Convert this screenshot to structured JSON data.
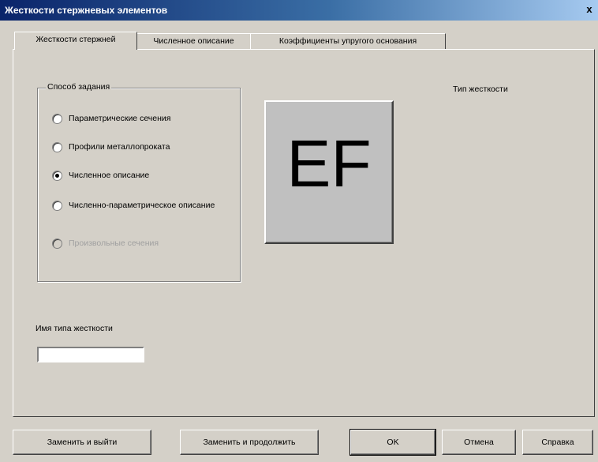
{
  "window": {
    "title": "Жесткости стержневых элементов",
    "close_glyph": "x"
  },
  "tabs": [
    {
      "label": "Жесткости стержней",
      "active": true
    },
    {
      "label": "Численное описание",
      "active": false
    },
    {
      "label": "Коэффициенты упругого основания",
      "active": false
    }
  ],
  "method_group": {
    "legend": "Способ задания",
    "options": [
      {
        "label": "Параметрические сечения",
        "checked": false,
        "disabled": false
      },
      {
        "label": "Профили металлопроката",
        "checked": false,
        "disabled": false
      },
      {
        "label": "Численное описание",
        "checked": true,
        "disabled": false
      },
      {
        "label": "Численно-параметрическое описание",
        "checked": false,
        "disabled": false
      },
      {
        "label": "Произвольные сечения",
        "checked": false,
        "disabled": true
      }
    ]
  },
  "stiffness_type": {
    "label": "Тип жесткости",
    "symbol": "EF"
  },
  "name_field": {
    "label": "Имя типа жесткости",
    "value": ""
  },
  "buttons": {
    "replace_exit": "Заменить и выйти",
    "replace_continue": "Заменить и продолжить",
    "ok": "OK",
    "cancel": "Отмена",
    "help": "Справка"
  }
}
